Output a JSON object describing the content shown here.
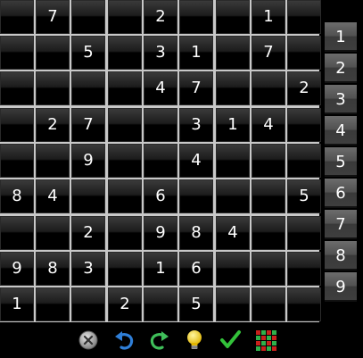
{
  "grid": [
    [
      "",
      "7",
      "",
      "",
      "2",
      "",
      "",
      "1",
      ""
    ],
    [
      "",
      "",
      "5",
      "",
      "3",
      "1",
      "",
      "7",
      ""
    ],
    [
      "",
      "",
      "",
      "",
      "4",
      "7",
      "",
      "",
      "2"
    ],
    [
      "",
      "2",
      "7",
      "",
      "",
      "3",
      "1",
      "4",
      ""
    ],
    [
      "",
      "",
      "9",
      "",
      "",
      "4",
      "",
      "",
      ""
    ],
    [
      "8",
      "4",
      "",
      "",
      "6",
      "",
      "",
      "",
      "5"
    ],
    [
      "",
      "",
      "2",
      "",
      "9",
      "8",
      "4",
      "",
      ""
    ],
    [
      "9",
      "8",
      "3",
      "",
      "1",
      "6",
      "",
      "",
      ""
    ],
    [
      "1",
      "",
      "",
      "2",
      "",
      "5",
      "",
      "",
      ""
    ]
  ],
  "number_picker": [
    "1",
    "2",
    "3",
    "4",
    "5",
    "6",
    "7",
    "8",
    "9"
  ],
  "toolbar": {
    "icons": [
      "clear-icon",
      "undo-icon",
      "redo-icon",
      "hint-bulb-icon",
      "check-icon",
      "grid-icon"
    ]
  },
  "colors": {
    "board_lines": "#c8c8c8",
    "cell_text": "#ffffff",
    "undo_blue": "#2f7fd8",
    "redo_green": "#3fbf5a",
    "bulb_yellow": "#f5d316",
    "check_green": "#33c23a",
    "grid_red": "#c8201c",
    "grid_green": "#2fb04a"
  }
}
